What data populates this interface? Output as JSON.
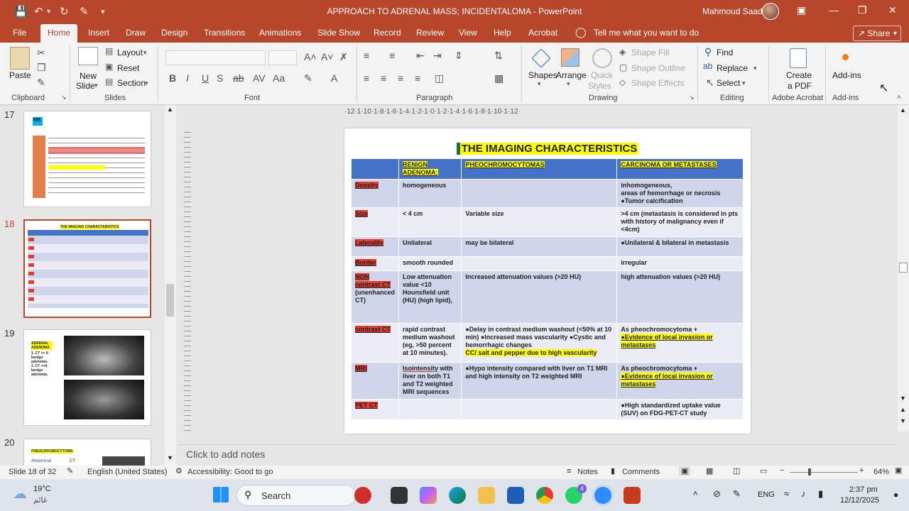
{
  "window": {
    "title": "APPROACH TO ADRENAL MASS; INCIDENTALOMA  -  PowerPoint",
    "user": "Mahmoud Saad"
  },
  "menu_tabs": [
    "File",
    "Home",
    "Insert",
    "Draw",
    "Design",
    "Transitions",
    "Animations",
    "Slide Show",
    "Record",
    "Review",
    "View",
    "Help",
    "Acrobat"
  ],
  "tell_me": "Tell me what you want to do",
  "share_label": "Share",
  "ribbon": {
    "clipboard": {
      "paste": "Paste",
      "group": "Clipboard"
    },
    "slides": {
      "new_slide_1": "New",
      "new_slide_2": "Slide",
      "layout": "Layout",
      "reset": "Reset",
      "section": "Section",
      "group": "Slides"
    },
    "font": {
      "group": "Font"
    },
    "paragraph": {
      "group": "Paragraph"
    },
    "drawing": {
      "shapes": "Shapes",
      "arrange": "Arrange",
      "quick_styles_1": "Quick",
      "quick_styles_2": "Styles",
      "shape_fill": "Shape Fill",
      "shape_outline": "Shape Outline",
      "shape_effects": "Shape Effects",
      "group": "Drawing"
    },
    "editing": {
      "find": "Find",
      "replace": "Replace",
      "select": "Select",
      "group": "Editing"
    },
    "acrobat": {
      "create_1": "Create",
      "create_2": "a PDF",
      "group": "Adobe Acrobat"
    },
    "addins": {
      "label": "Add-ins",
      "group": "Add-ins"
    }
  },
  "thumbnails": [
    {
      "num": "17",
      "title": "NB"
    },
    {
      "num": "18",
      "title": "THE IMAGING CHARACTERISTICS"
    },
    {
      "num": "19",
      "title": "ADRENAL ADENOMA",
      "lines": [
        "1. CT >> It",
        "benign",
        "adenoma.",
        "2. CT >>It",
        "benign",
        "adenoma."
      ]
    },
    {
      "num": "20",
      "title": "PHEOCHROMOCYTOMA",
      "sub": "Abdominal",
      "sub2": "CT"
    }
  ],
  "ruler": "·12·1·10·1·8·1·6·1·4·1·2·1·0·1·2·1·4·1·6·1·8·1·10·1·12·",
  "slide": {
    "title": "THE IMAGING CHARACTERISTICS",
    "headers": [
      "",
      "BENIGN ADENOMA:",
      "PHEOCHROMOCYTOMAS",
      "CARCINOMA OR METASTASES"
    ],
    "rows": [
      {
        "label": "Density",
        "c1": "homogeneous",
        "c2": "",
        "c3a": "inhomogeneous,",
        "c3b": "areas of hemorrhage or necrosis",
        "c3c": "●Tumor calcification"
      },
      {
        "label": "Size",
        "c1": "< 4 cm",
        "c2": "Variable size",
        "c3": ">4 cm (metastasis is considered in pts with history of malignancy even if <4cm)"
      },
      {
        "label": "Laterality",
        "c1": "Unilateral",
        "c2": "may be bilateral",
        "c3": "●Unilateral & bilateral in metastasis"
      },
      {
        "label": "Border",
        "c1": "smooth rounded",
        "c2": "",
        "c3": "irregular"
      },
      {
        "label": "NON contrast CT",
        "label2": "(unenhanced CT)",
        "c1": "Low attenuation value <10 Hounsfield unit (HU) (high lipid),",
        "c2": "Increased attenuation values (>20 HU)",
        "c3": "high attenuation values (>20 HU)"
      },
      {
        "label": "contrast CT",
        "c1": "rapid contrast medium washout (eg, >50 percent at 10 minutes).",
        "c2": "●Delay in contrast medium washout (<50% at 10 min) ●Increased mass vascularity ●Cystic and hemorrhagic changes",
        "c2b": "CC/ salt and pepper due to high vascularity",
        "c3": "As pheochromocytoma +",
        "c3b": "●Evidence of local invasion or metastases"
      },
      {
        "label": "MRI",
        "c1a": "Isointensity",
        "c1b": " with liver on both T1 and T2 weighted MRI sequences",
        "c2": "●Hypo intensity compared with liver on T1 MRI and high intensity on T2 weighted MRI",
        "c3": "As pheochromocytoma +",
        "c3b": "●Evidence of local invasion or metastases"
      },
      {
        "label": "PET CT",
        "c1": "",
        "c2": "",
        "c3": "●High standardized uptake value (SUV) on FDG-PET-CT study"
      }
    ]
  },
  "notes_placeholder": "Click to add notes",
  "status": {
    "slide": "Slide 18 of 32",
    "language": "English (United States)",
    "accessibility": "Accessibility: Good to go",
    "notes": "Notes",
    "comments": "Comments",
    "zoom": "64%"
  },
  "taskbar": {
    "weather_temp": "19°C",
    "weather_desc": "غائم",
    "search": "Search",
    "lang": "ENG",
    "time": "2:37 pm",
    "date": "12/12/2025",
    "badge": "4"
  },
  "colors": {
    "accent": "#b7472a",
    "table_header": "#4472c4",
    "row_dark": "#cfd5ea",
    "row_light": "#e9ebf5",
    "highlight_yellow": "#ffff00",
    "label_red": "#e03c31"
  }
}
